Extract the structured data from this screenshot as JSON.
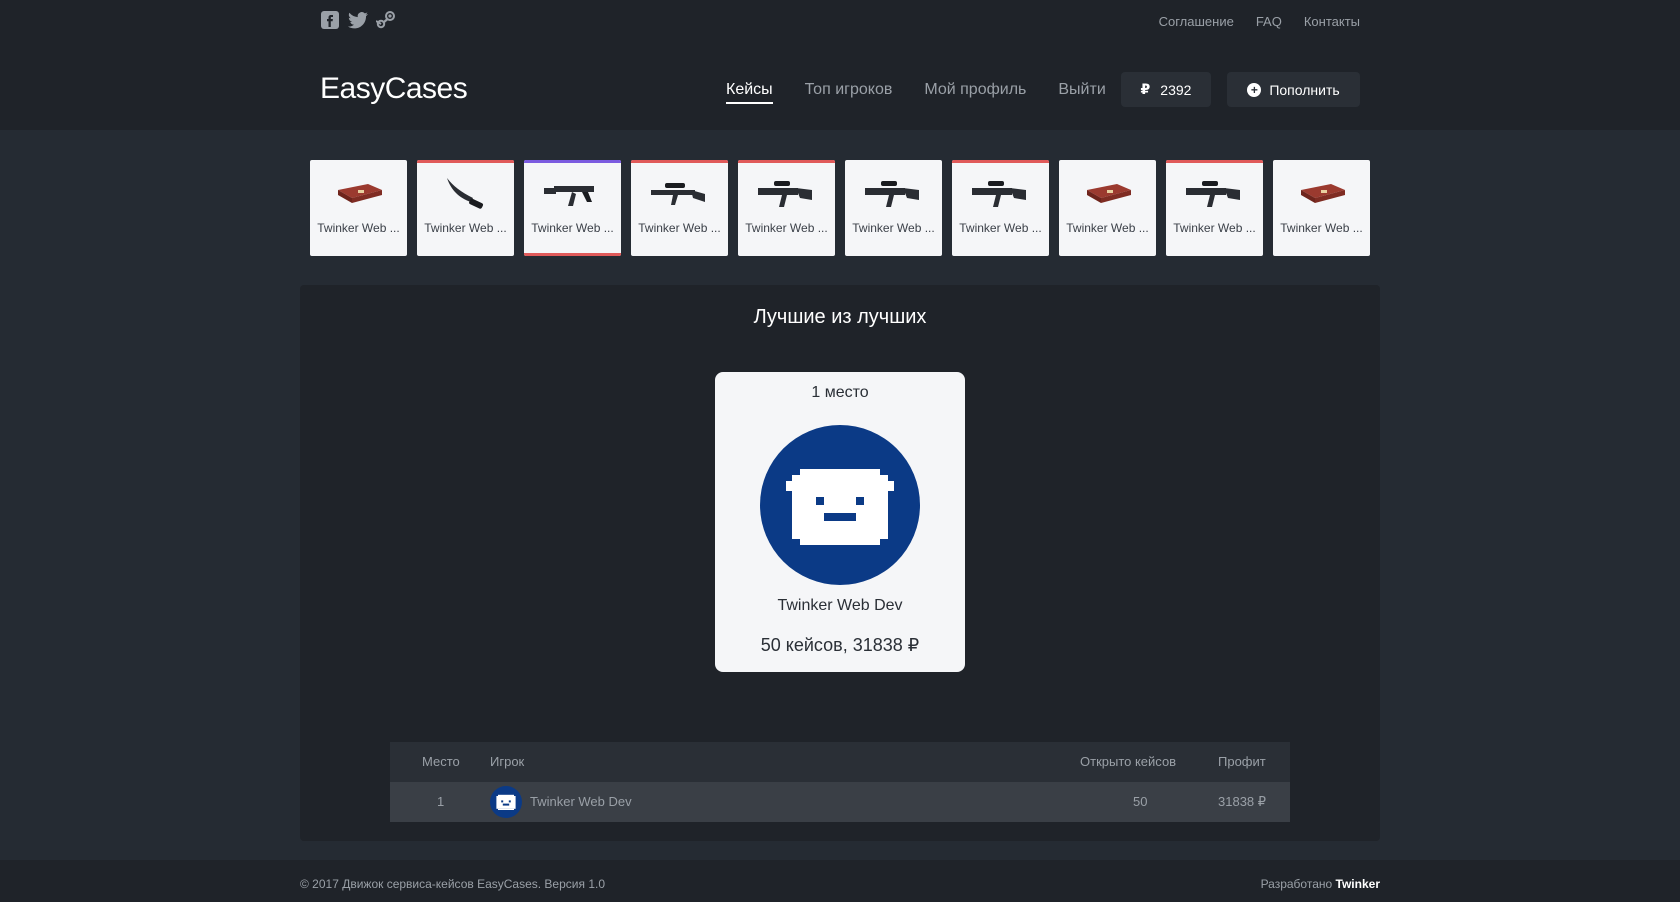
{
  "header": {
    "social": [
      "facebook-icon",
      "twitter-icon",
      "steam-icon"
    ],
    "top_links": [
      "Соглашение",
      "FAQ",
      "Контакты"
    ],
    "logo": "EasyCases",
    "nav": [
      {
        "label": "Кейсы",
        "active": true
      },
      {
        "label": "Топ игроков",
        "active": false
      },
      {
        "label": "Мой профиль",
        "active": false
      },
      {
        "label": "Выйти",
        "active": false
      }
    ],
    "balance": "2392",
    "currency_symbol": "₽",
    "topup_label": "Пополнить"
  },
  "drops": [
    {
      "label": "Twinker Web ...",
      "item": "case",
      "rarity_color": ""
    },
    {
      "label": "Twinker Web ...",
      "item": "knife",
      "rarity_color": "#e05a5a"
    },
    {
      "label": "Twinker Web ...",
      "item": "rifle",
      "rarity_color": "#7b5be0",
      "bottom_color": "#e05a5a"
    },
    {
      "label": "Twinker Web ...",
      "item": "sniper",
      "rarity_color": "#e05a5a"
    },
    {
      "label": "Twinker Web ...",
      "item": "smg",
      "rarity_color": "#e05a5a"
    },
    {
      "label": "Twinker Web ...",
      "item": "smg",
      "rarity_color": ""
    },
    {
      "label": "Twinker Web ...",
      "item": "smg",
      "rarity_color": "#e05a5a"
    },
    {
      "label": "Twinker Web ...",
      "item": "case",
      "rarity_color": ""
    },
    {
      "label": "Twinker Web ...",
      "item": "smg",
      "rarity_color": "#e05a5a"
    },
    {
      "label": "Twinker Web ...",
      "item": "case",
      "rarity_color": ""
    }
  ],
  "best": {
    "title": "Лучшие из лучших",
    "place": "1 место",
    "name": "Twinker Web Dev",
    "stats": "50 кейсов, 31838 ₽"
  },
  "table": {
    "headers": {
      "place": "Место",
      "player": "Игрок",
      "opened": "Открыто кейсов",
      "profit": "Профит"
    },
    "rows": [
      {
        "place": "1",
        "player": "Twinker Web Dev",
        "opened": "50",
        "profit": "31838 ₽"
      }
    ]
  },
  "footer": {
    "copyright": "© 2017 Движок сервиса-кейсов EasyCases. Версия 1.0",
    "dev_prefix": "Разработано",
    "dev_name": "Twinker"
  },
  "colors": {
    "background": "#252b33",
    "header": "#1f2329",
    "avatar": "#0b3a86",
    "rare": "#e05a5a",
    "mythic": "#7b5be0"
  }
}
